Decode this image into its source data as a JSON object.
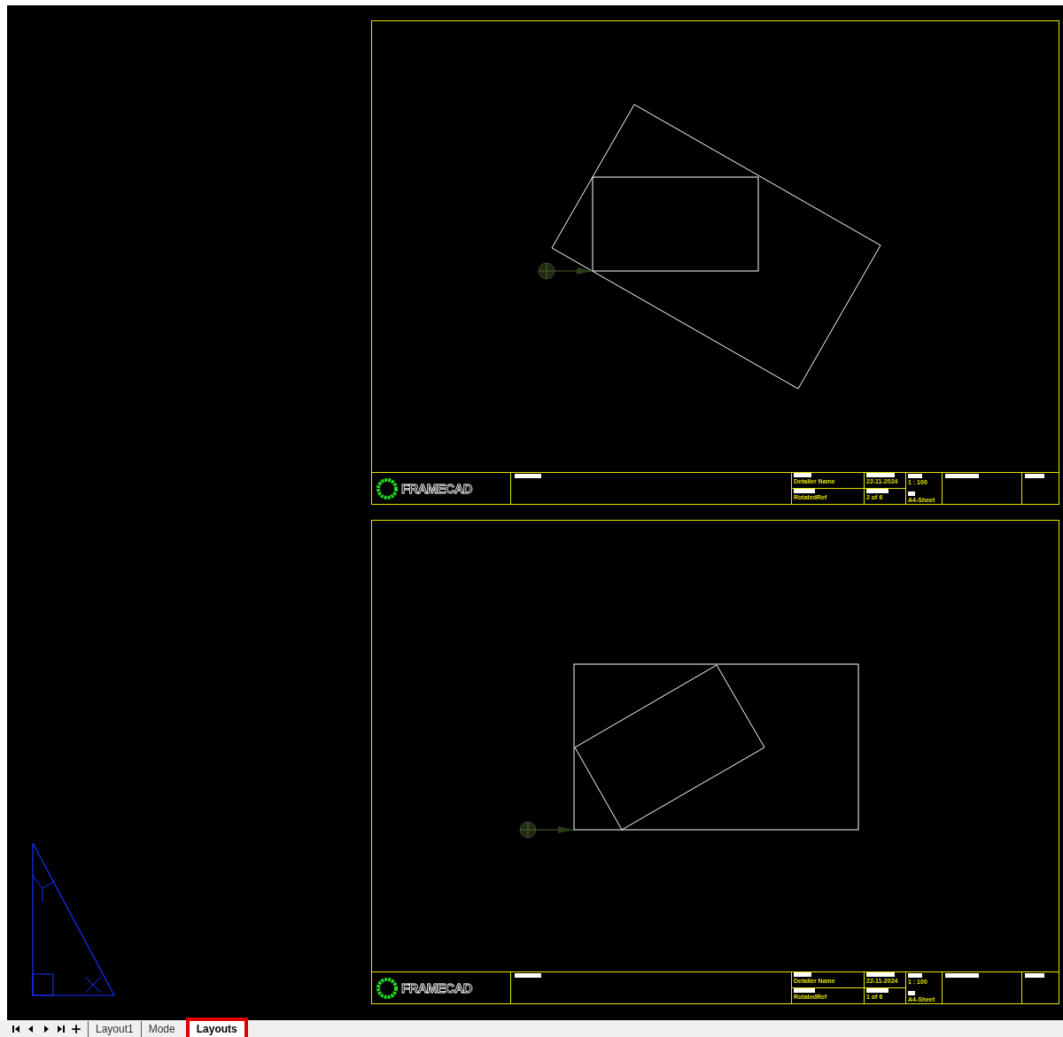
{
  "sheets": [
    {
      "logo": "FRAMECAD",
      "detailer": "Detailer Name",
      "date": "22-11-2024",
      "ref": "RotatedRef",
      "page": "2 of 6",
      "scale": "1 : 100",
      "size": "A4-Sheet"
    },
    {
      "logo": "FRAMECAD",
      "detailer": "Detailer Name",
      "date": "22-11-2024",
      "ref": "RotatedRef",
      "page": "1 of 6",
      "scale": "1 : 100",
      "size": "A4-Sheet"
    }
  ],
  "tabs": [
    {
      "label": "Layout1",
      "selected": false,
      "highlighted": false
    },
    {
      "label": "Mode",
      "selected": false,
      "highlighted": false
    },
    {
      "label": "Layouts",
      "selected": true,
      "highlighted": true
    }
  ]
}
